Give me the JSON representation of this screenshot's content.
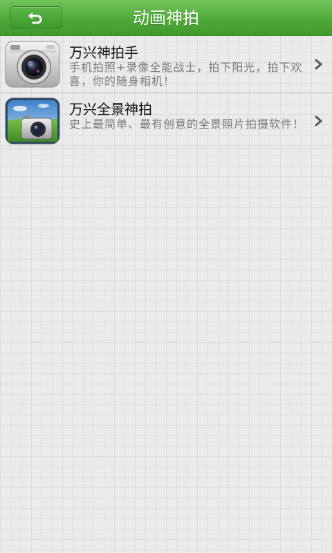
{
  "header": {
    "title": "动画神拍",
    "back_icon": "back-arrow-icon",
    "background": "#4faa3a"
  },
  "apps": [
    {
      "name": "万兴神拍手",
      "description": "手机拍照+录像全能战士，拍下阳光，拍下欢喜，你的随身相机！",
      "icon": "camera-app-icon"
    },
    {
      "name": "万兴全景神拍",
      "description": "史上最简单、最有创意的全景照片拍摄软件！",
      "icon": "panorama-camera-app-icon"
    }
  ],
  "row_chevron_icon": "chevron-right-icon"
}
